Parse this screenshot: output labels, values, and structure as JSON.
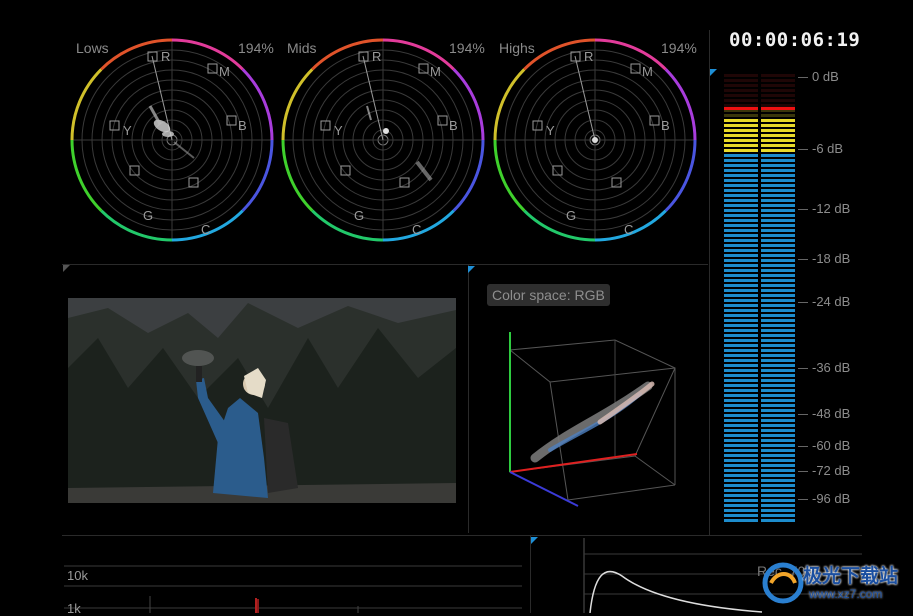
{
  "timecode": "00:00:06:19",
  "color_wheels": [
    {
      "label": "Lows",
      "percent": "194%"
    },
    {
      "label": "Mids",
      "percent": "194%"
    },
    {
      "label": "Highs",
      "percent": "194%"
    }
  ],
  "wheel_targets": [
    "R",
    "M",
    "B",
    "C",
    "G",
    "Y"
  ],
  "audio_meter": {
    "labels": [
      "0 dB",
      "-6 dB",
      "-12 dB",
      "-18 dB",
      "-24 dB",
      "-36 dB",
      "-48 dB",
      "-60 dB",
      "-72 dB",
      "-96 dB"
    ],
    "level_left": 0.9,
    "level_right": 0.9,
    "colors": {
      "red": "#7a1616",
      "yellow": "#e8d92a",
      "blue": "#1d8ccc"
    }
  },
  "color_space": {
    "label": "Color space: RGB"
  },
  "histogram": {
    "labels": [
      "10k",
      "1k"
    ]
  },
  "rec_label": "Rec. 709",
  "watermark": {
    "text": "极光下载站",
    "url": "www.xz7.com"
  },
  "accent": "#1e8fd6"
}
